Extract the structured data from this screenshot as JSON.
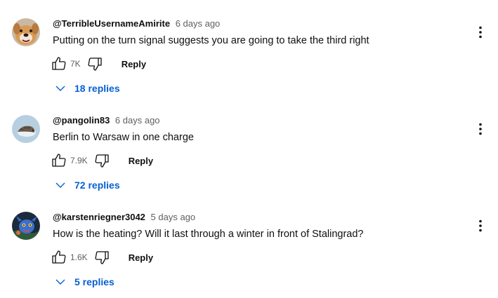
{
  "comments": [
    {
      "author": "@TerribleUsernameAmirite",
      "time": "6 days ago",
      "text": "Putting on the turn signal suggests you are going to take the third right",
      "likes": "7K",
      "reply_label": "Reply",
      "replies_label": "18 replies",
      "avatar_icon": "dog-face-avatar"
    },
    {
      "author": "@pangolin83",
      "time": "6 days ago",
      "text": "Berlin to Warsaw in one charge",
      "likes": "7.9K",
      "reply_label": "Reply",
      "replies_label": "72 replies",
      "avatar_icon": "pangolin-avatar"
    },
    {
      "author": "@karstenriegner3042",
      "time": "5 days ago",
      "text": "How is the heating? Will it last through a winter in front of Stalingrad?",
      "likes": "1.6K",
      "reply_label": "Reply",
      "replies_label": "5 replies",
      "avatar_icon": "blue-creature-avatar"
    }
  ],
  "colors": {
    "link_blue": "#065fd4",
    "secondary_text": "#606060",
    "primary_text": "#0f0f0f"
  }
}
